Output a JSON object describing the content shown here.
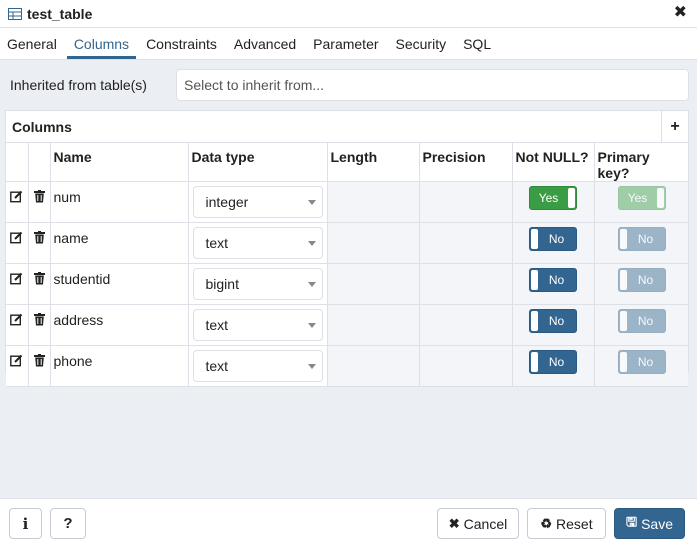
{
  "window": {
    "title": "test_table",
    "close_icon": "close-icon"
  },
  "tabs": [
    {
      "label": "General",
      "active": false
    },
    {
      "label": "Columns",
      "active": true
    },
    {
      "label": "Constraints",
      "active": false
    },
    {
      "label": "Advanced",
      "active": false
    },
    {
      "label": "Parameter",
      "active": false
    },
    {
      "label": "Security",
      "active": false
    },
    {
      "label": "SQL",
      "active": false
    }
  ],
  "inherit": {
    "label": "Inherited from table(s)",
    "placeholder": "Select to inherit from..."
  },
  "columns_grid": {
    "title": "Columns",
    "add_icon": "plus-icon",
    "headers": [
      "Name",
      "Data type",
      "Length",
      "Precision",
      "Not NULL?",
      "Primary key?"
    ],
    "rows": [
      {
        "name": "num",
        "data_type": "integer",
        "length": "",
        "precision": "",
        "not_null": "Yes",
        "primary_key": "Yes"
      },
      {
        "name": "name",
        "data_type": "text",
        "length": "",
        "precision": "",
        "not_null": "No",
        "primary_key": "No"
      },
      {
        "name": "studentid",
        "data_type": "bigint",
        "length": "",
        "precision": "",
        "not_null": "No",
        "primary_key": "No"
      },
      {
        "name": "address",
        "data_type": "text",
        "length": "",
        "precision": "",
        "not_null": "No",
        "primary_key": "No"
      },
      {
        "name": "phone",
        "data_type": "text",
        "length": "",
        "precision": "",
        "not_null": "No",
        "primary_key": "No"
      }
    ]
  },
  "footer": {
    "info_icon": "info-icon",
    "help_label": "?",
    "cancel_label": "Cancel",
    "reset_label": "Reset",
    "save_label": "Save"
  },
  "colors": {
    "accent": "#326690",
    "yes_green": "#3a9d46"
  }
}
